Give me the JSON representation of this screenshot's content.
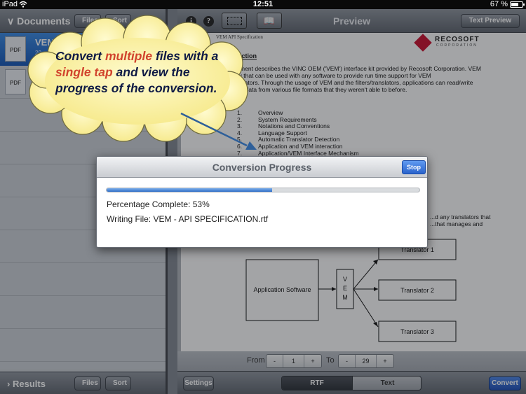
{
  "status_bar": {
    "device": "iPad",
    "time": "12:51",
    "battery": "67 %",
    "battery_fraction": 0.67
  },
  "left_panel": {
    "header_title": "Documents",
    "files_label": "Files",
    "sort_label": "Sort",
    "documents": [
      {
        "icon": "PDF",
        "name": "VEM",
        "meta": "29 ...",
        "selected": true
      },
      {
        "icon": "PDF",
        "name": "",
        "meta": "",
        "selected": false
      }
    ],
    "footer_title": "Results",
    "footer_files_label": "Files",
    "footer_sort_label": "Sort"
  },
  "right_panel": {
    "header_title": "Preview",
    "text_preview_label": "Text Preview",
    "info_icon_glyph": "i",
    "help_icon_glyph": "?",
    "book_icon_glyph": "📖",
    "document": {
      "running_head": "VEM API Specification",
      "logo_text": "RECOSOFT",
      "logo_sub": "CORPORATION",
      "intro_heading": "...duction",
      "intro_lines": [
        "...cument describes the VINC OEM ('VEM') interface kit provided by Recosoft Corporation.  VEM",
        "...ary that can be used with any software to provide run time support for VEM",
        "...anslators.  Through the usage of VEM and the filters/translators, applications can read/write",
        "...ract data from various file formats that they weren't able to before."
      ],
      "outline_heading": "...utline",
      "outline": [
        {
          "num": "1.",
          "text": "Overview"
        },
        {
          "num": "2.",
          "text": "System Requirements"
        },
        {
          "num": "3.",
          "text": "Notations and Conventions"
        },
        {
          "num": "4.",
          "text": "Language Support"
        },
        {
          "num": "5.",
          "text": "Automatic Translator Detection"
        },
        {
          "num": "6.",
          "text": "Application and VEM interaction"
        },
        {
          "num": "7.",
          "text": "Application/VEM Interface Mechanism"
        }
      ],
      "para_lines": [
        "...d any translators that",
        "...that manages and"
      ],
      "diagram": {
        "app_label": "Application Software",
        "vem_letters": [
          "V",
          "E",
          "M"
        ],
        "translators": [
          "Translator 1",
          "Translator 2",
          "Translator 3"
        ]
      }
    },
    "range": {
      "from_label": "From",
      "to_label": "To",
      "minus": "-",
      "plus": "+",
      "from_value": "1",
      "to_value": "29"
    },
    "footer": {
      "settings_label": "Settings",
      "seg_rtf": "RTF",
      "seg_text": "Text",
      "convert_label": "Convert"
    }
  },
  "dialog": {
    "title": "Conversion Progress",
    "stop_label": "Stop",
    "progress_fraction": 0.53,
    "percent_line": "Percentage Complete: 53%",
    "writing_line": "Writing File: VEM - API SPECIFICATION.rtf"
  },
  "callout": {
    "parts": [
      {
        "text": "Convert ",
        "hl": false
      },
      {
        "text": "multiple",
        "hl": true
      },
      {
        "text": " files with a ",
        "hl": false
      },
      {
        "text": "single tap",
        "hl": true
      },
      {
        "text": " and view the progress of the conversion.",
        "hl": false
      }
    ]
  },
  "colors": {
    "accent_blue": "#2a63cc",
    "highlight_red": "#d1432d",
    "callout_fill": "#fbf3a4",
    "callout_text": "#0f1a45"
  }
}
